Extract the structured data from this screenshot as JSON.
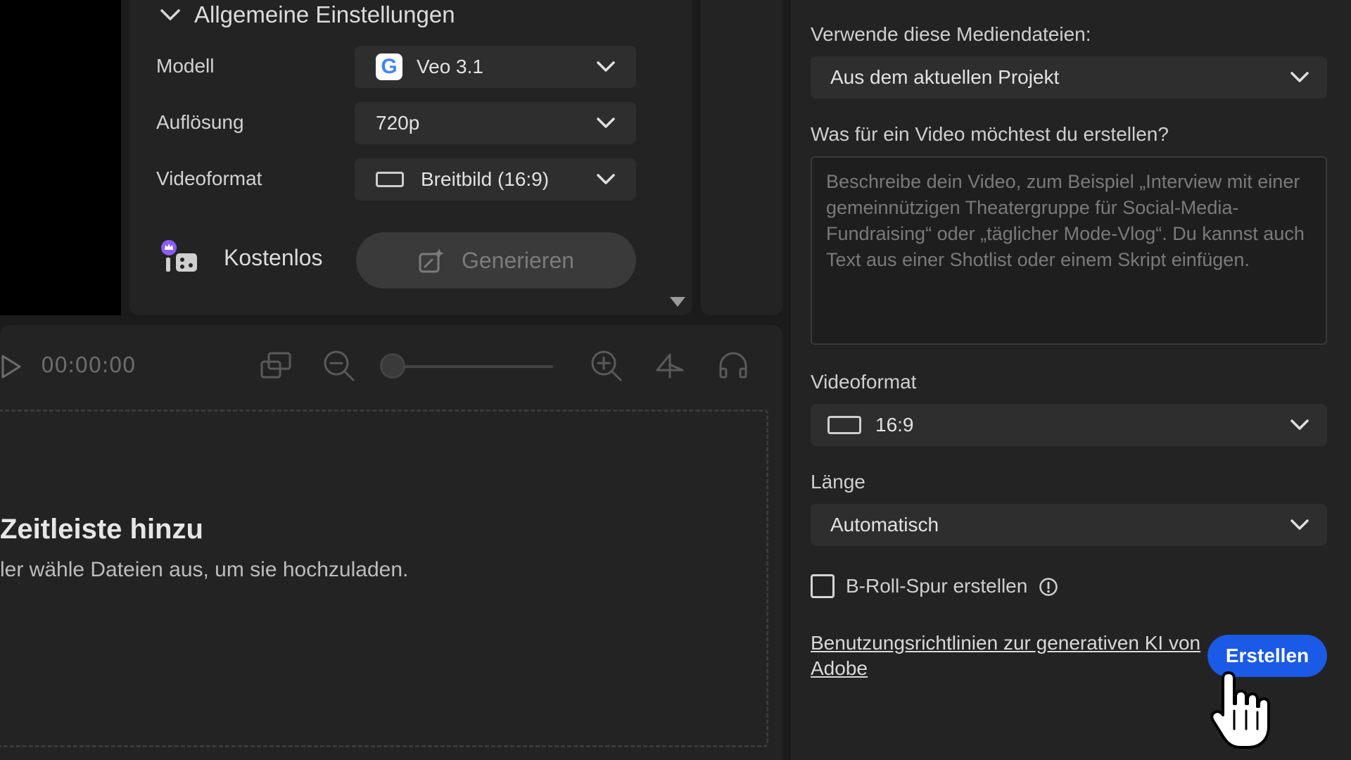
{
  "settings": {
    "section_title": "Allgemeine Einstellungen",
    "model_label": "Modell",
    "model_value": "Veo 3.1",
    "resolution_label": "Auflösung",
    "resolution_value": "720p",
    "format_label": "Videoformat",
    "format_value": "Breitbild (16:9)",
    "credits_label": "Kostenlos",
    "generate_label": "Generieren"
  },
  "timeline": {
    "timecode": "00:00:00",
    "drop_title": "Zeitleiste hinzu",
    "drop_subtitle": "ler wähle Dateien aus, um sie hochzuladen."
  },
  "right": {
    "media_label": "Verwende diese Mediendateien:",
    "media_value": "Aus dem aktuellen Projekt",
    "prompt_label": "Was für ein Video möchtest du erstellen?",
    "prompt_placeholder": "Beschreibe dein Video, zum Beispiel „Interview mit einer gemeinnützigen Theatergruppe für Social-Media-Fundraising“ oder „täglicher Mode-Vlog“. Du kannst auch Text aus einer Shotlist oder einem Skript einfügen.",
    "format_label": "Videoformat",
    "format_value": "16:9",
    "length_label": "Länge",
    "length_value": "Automatisch",
    "broll_label": "B-Roll-Spur erstellen",
    "guidelines_link": "Benutzungsrichtlinien zur generativen KI von Adobe",
    "create_label": "Erstellen"
  },
  "icons": [
    "chevron-down-icon",
    "google-logo-icon",
    "aspect-ratio-icon",
    "credits-icon",
    "generate-icon",
    "play-icon",
    "fit-icon",
    "zoom-out-icon",
    "zoom-in-icon",
    "snap-icon",
    "audio-icon",
    "info-icon",
    "hand-cursor-icon"
  ],
  "colors": {
    "accent": "#1a5ae6",
    "panel": "#232323",
    "background": "#1b1b1b"
  }
}
